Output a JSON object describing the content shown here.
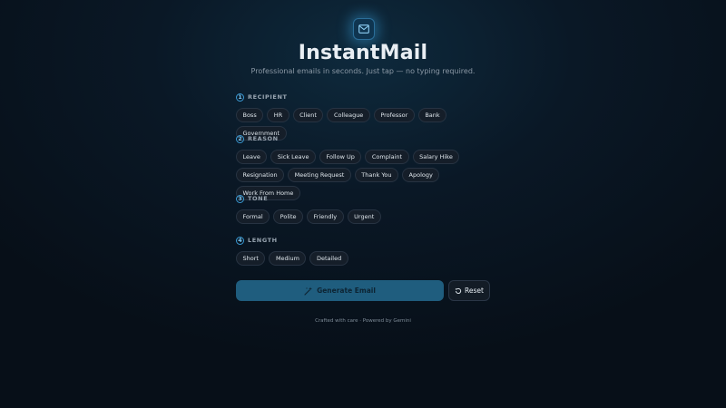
{
  "app": {
    "title": "InstantMail",
    "subtitle": "Professional emails in seconds. Just tap — no typing required.",
    "logo_icon": "mail-icon"
  },
  "sections": {
    "recipient": {
      "number": "1",
      "label": "RECIPIENT",
      "options": [
        "Boss",
        "HR",
        "Client",
        "Colleague",
        "Professor",
        "Bank",
        "Government"
      ]
    },
    "reason": {
      "number": "2",
      "label": "REASON",
      "options": [
        "Leave",
        "Sick Leave",
        "Follow Up",
        "Complaint",
        "Salary Hike",
        "Resignation",
        "Meeting Request",
        "Thank You",
        "Apology",
        "Work From Home"
      ]
    },
    "tone": {
      "number": "3",
      "label": "TONE",
      "options": [
        "Formal",
        "Polite",
        "Friendly",
        "Urgent"
      ]
    },
    "length": {
      "number": "4",
      "label": "LENGTH",
      "options": [
        "Short",
        "Medium",
        "Detailed"
      ]
    }
  },
  "actions": {
    "generate_label": "Generate Email",
    "generate_icon": "sparkles-icon",
    "reset_label": "Reset",
    "reset_icon": "reset-icon"
  },
  "footer": {
    "text": "Crafted with care · Powered by Gemini"
  },
  "colors": {
    "accent": "#3a9ad4",
    "generate_button": "#1f5d7e",
    "chip_bg": "#151e29"
  }
}
